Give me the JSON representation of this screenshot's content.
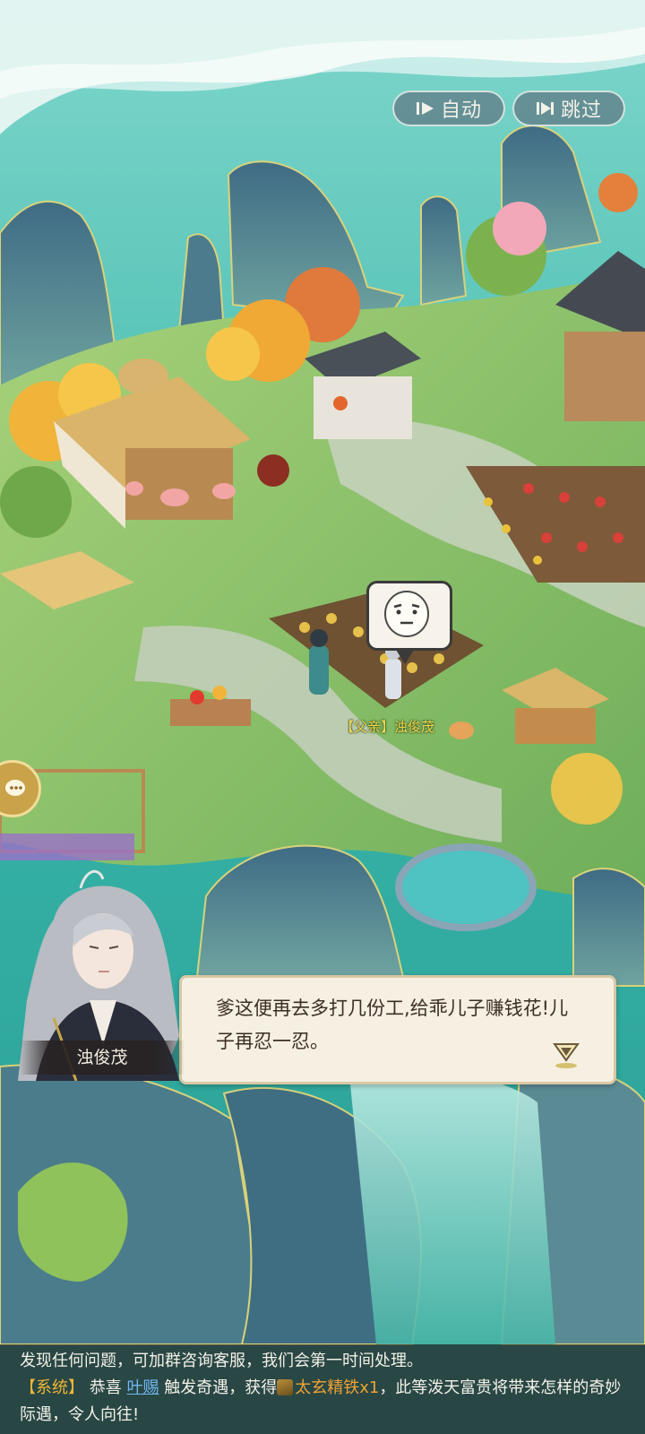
{
  "controls": {
    "auto_label": "自动",
    "skip_label": "跳过"
  },
  "scene": {
    "npc_name_tag": "【父亲】浊俊茂"
  },
  "dialog": {
    "speaker": "浊俊茂",
    "text": "爹这便再去多打几份工,给乖儿子赚钱花!儿子再忍一忍。"
  },
  "notice": {
    "line1": "发现任何问题，可加群咨询客服，我们会第一时间处理。",
    "system_tag": "【系统】",
    "congrats": "恭喜",
    "player": "叶赐",
    "event_text": "触发奇遇，获得",
    "item": "太玄精铁x1",
    "tail": "，此等泼天富贵将带来怎样的奇妙际遇，令人向往!"
  },
  "colors": {
    "sea": "#3fbfb0",
    "grass": "#8cc46a",
    "dialog_bg": "#f6f0e2",
    "system_tag": "#f0b634",
    "player_link": "#6fb7f2",
    "item": "#f0a235"
  }
}
